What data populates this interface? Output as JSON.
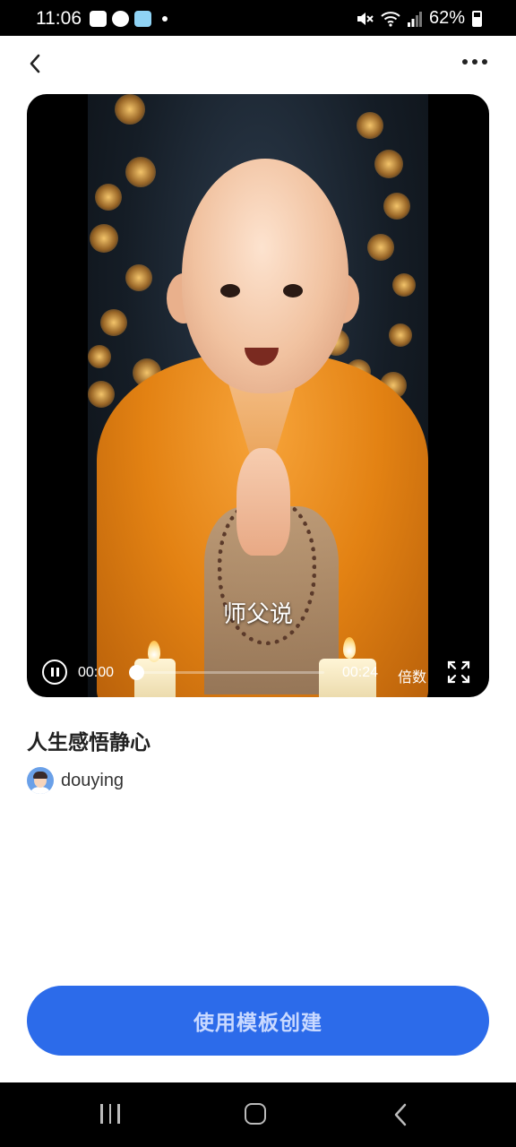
{
  "status_bar": {
    "time": "11:06",
    "battery": "62%",
    "icons": [
      "gallery-icon",
      "cloud-icon",
      "weather-icon",
      "notification-dot",
      "mute-icon",
      "wifi-icon",
      "signal-icon",
      "battery-icon"
    ]
  },
  "header": {
    "back_icon": "chevron-left-icon",
    "more_icon": "more-horizontal-icon"
  },
  "video": {
    "subtitle": "师父说",
    "current_time": "00:00",
    "total_time": "00:24",
    "speed_label": "倍数",
    "progress": 0,
    "state": "playing"
  },
  "template": {
    "title": "人生感悟静心",
    "author": "douying"
  },
  "actions": {
    "create_label": "使用模板创建"
  },
  "colors": {
    "accent": "#2c6bea",
    "button_text": "#c9d9ff",
    "robe": "#e38213"
  }
}
